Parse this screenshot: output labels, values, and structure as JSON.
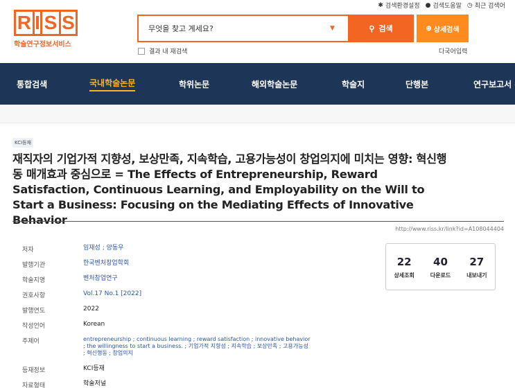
{
  "util": {
    "settings": "검색환경설정",
    "help": "검색도움말",
    "recent": "최근 검색어"
  },
  "logo": {
    "letters": [
      "R",
      "I",
      "S",
      "S"
    ],
    "sub": "학술연구정보서비스"
  },
  "search": {
    "placeholder": "무엇을 찾고 계세요?",
    "button": "검색",
    "advanced": "상세검색",
    "within_results": "결과 내 재검색",
    "multilang": "다국어입력"
  },
  "nav": {
    "items": [
      {
        "label": "통합검색"
      },
      {
        "label": "국내학술논문"
      },
      {
        "label": "학위논문"
      },
      {
        "label": "해외학술논문"
      },
      {
        "label": "학술지"
      },
      {
        "label": "단행본"
      },
      {
        "label": "연구보고서"
      }
    ]
  },
  "article": {
    "badge": "KCI등재",
    "title": "재직자의 기업가적 지향성, 보상만족, 지속학습, 고용가능성이 창업의지에 미치는 영향: 혁신행동 매개효과 중심으로 = The Effects of Entrepreneurship, Reward Satisfaction, Continuous Learning, and Employability on the Will to Start a Business: Focusing on the Mediating Effects of Innovative Behavior",
    "url": "http://www.riss.kr/link?id=A108044404",
    "meta": [
      {
        "label": "저자",
        "value": "임재성 ; 양동우"
      },
      {
        "label": "발행기관",
        "value": "한국벤처창업학회"
      },
      {
        "label": "학술지명",
        "value": "벤처창업연구"
      },
      {
        "label": "권호사항",
        "value": "Vol.17 No.1 [2022]"
      },
      {
        "label": "발행연도",
        "value": "2022"
      },
      {
        "label": "작성언어",
        "value": "Korean"
      },
      {
        "label": "주제어",
        "value": "entrepreneurship ; continuous learning ; reward satisfaction ; innovative behavior ; the willingness to start a business. ; 기업가적 지향성 ; 지속학습 ; 보상만족 ; 고용가능성 ; 혁신행동 ; 창업의지"
      },
      {
        "label": "등재정보",
        "value": "KCI등재"
      },
      {
        "label": "자료형태",
        "value": "학술저널"
      }
    ],
    "stats": [
      {
        "num": "22",
        "label": "상세조회"
      },
      {
        "num": "40",
        "label": "다운로드"
      },
      {
        "num": "27",
        "label": "내보내기"
      }
    ]
  }
}
